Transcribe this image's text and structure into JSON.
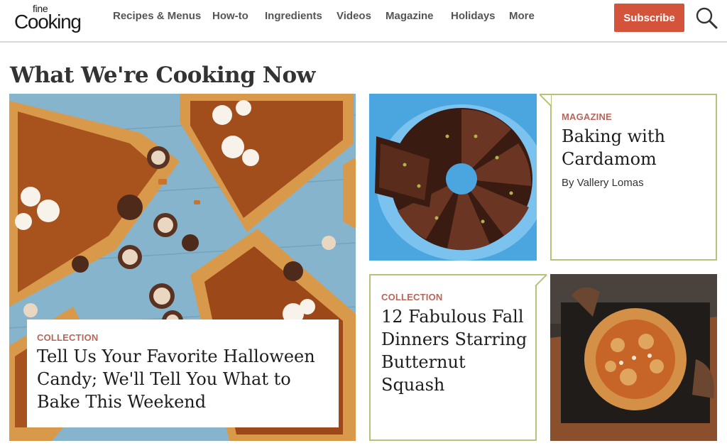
{
  "header": {
    "logo_small": "fine",
    "logo_main": "Cooking",
    "nav": [
      "Recipes & Menus",
      "How-to",
      "Ingredients",
      "Videos",
      "Magazine",
      "Holidays",
      "More"
    ],
    "subscribe": "Subscribe",
    "search_icon": "search-icon"
  },
  "section": {
    "title": "What We're Cooking Now"
  },
  "cards": {
    "feature": {
      "label": "COLLECTION",
      "title": "Tell Us Your Favorite Halloween Candy; We'll Tell You What to Bake This Weekend"
    },
    "magazine": {
      "label": "MAGAZINE",
      "title": "Baking with Cardamom",
      "byline": "By Vallery Lomas"
    },
    "collection": {
      "label": "COLLECTION",
      "title": "12 Fabulous Fall Dinners Starring Butternut Squash"
    }
  },
  "colors": {
    "accent": "#d4533b",
    "label": "#b9655a",
    "card_border": "#b5c27a"
  }
}
